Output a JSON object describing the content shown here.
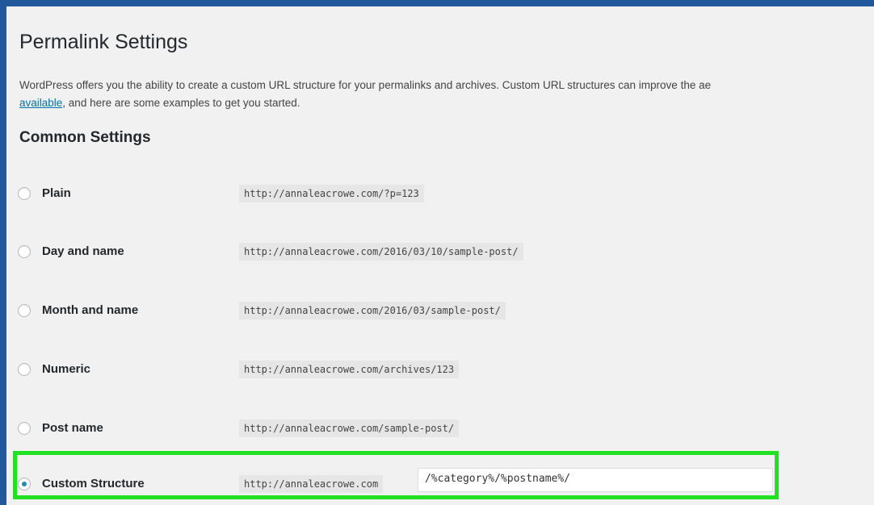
{
  "page": {
    "title": "Permalink Settings",
    "intro_line1": "WordPress offers you the ability to create a custom URL structure for your permalinks and archives. Custom URL structures can improve the ae",
    "intro_link": "available",
    "intro_line2_rest": ", and here are some examples to get you started.",
    "section_title": "Common Settings"
  },
  "options": [
    {
      "label": "Plain",
      "url": "http://annaleacrowe.com/?p=123",
      "selected": false
    },
    {
      "label": "Day and name",
      "url": "http://annaleacrowe.com/2016/03/10/sample-post/",
      "selected": false
    },
    {
      "label": "Month and name",
      "url": "http://annaleacrowe.com/2016/03/sample-post/",
      "selected": false
    },
    {
      "label": "Numeric",
      "url": "http://annaleacrowe.com/archives/123",
      "selected": false
    },
    {
      "label": "Post name",
      "url": "http://annaleacrowe.com/sample-post/",
      "selected": false
    }
  ],
  "custom": {
    "label": "Custom Structure",
    "base_url": "http://annaleacrowe.com",
    "value": "/%category%/%postname%/",
    "selected": true,
    "icon": "keyboard-icon"
  },
  "colors": {
    "frame": "#21589b",
    "highlight": "#22e022",
    "link": "#0073aa",
    "radio_selected": "#1e8cbe"
  }
}
